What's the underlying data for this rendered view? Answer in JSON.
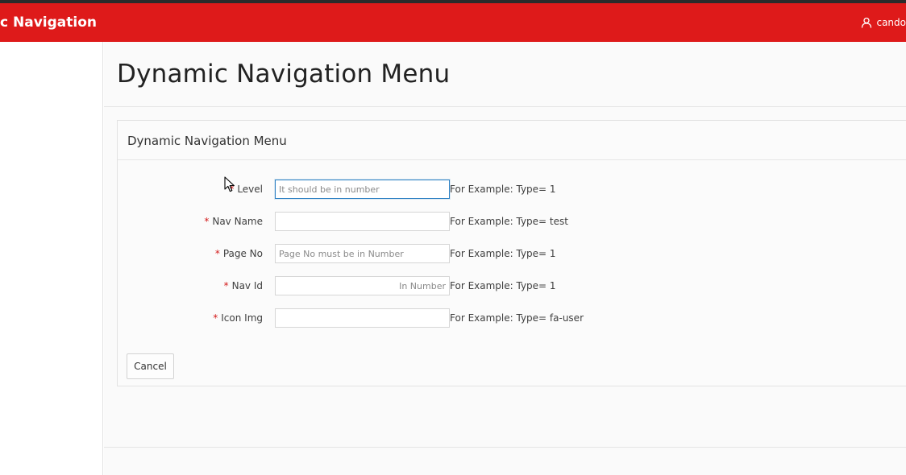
{
  "header": {
    "app_title": "c Navigation",
    "user_name": "cando",
    "colors": {
      "brand": "#de1a1a",
      "text": "#ffffff"
    },
    "user_icon": "user-icon"
  },
  "page": {
    "title": "Dynamic Navigation Menu"
  },
  "region": {
    "title": "Dynamic Navigation Menu",
    "fields": [
      {
        "label": "Level",
        "required": "*",
        "value": "",
        "placeholder": "It should be in number",
        "hint": "For Example: Type= 1"
      },
      {
        "label": "Nav Name",
        "required": "*",
        "value": "",
        "placeholder": "",
        "hint": "For Example: Type= test"
      },
      {
        "label": "Page No",
        "required": "*",
        "value": "",
        "placeholder": "Page No must be in Number",
        "hint": "For Example: Type= 1"
      },
      {
        "label": "Nav Id",
        "required": "*",
        "value": "",
        "placeholder": "In Number",
        "hint": "For Example: Type= 1"
      },
      {
        "label": "Icon Img",
        "required": "*",
        "value": "",
        "placeholder": "",
        "hint": "For Example: Type= fa-user"
      }
    ],
    "cancel_label": "Cancel"
  }
}
